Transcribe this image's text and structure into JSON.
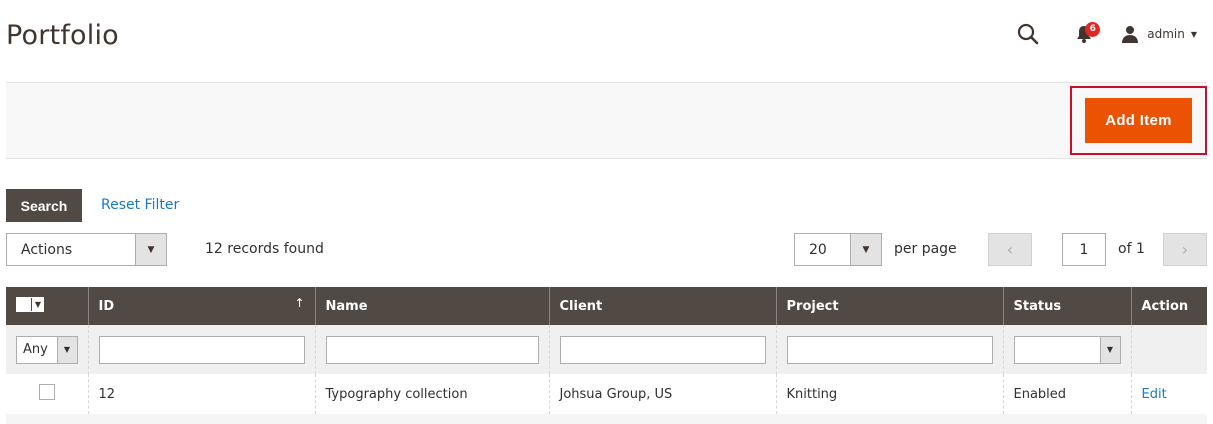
{
  "page": {
    "title": "Portfolio"
  },
  "header": {
    "notifications_count": "6",
    "user_name": "admin",
    "icons": {
      "search": "search-icon",
      "bell": "bell-icon",
      "user": "user-icon",
      "caret": "caret-down-icon"
    }
  },
  "actions_bar": {
    "add_label": "Add Item",
    "accent": "#eb5202",
    "highlight": "#c8102e"
  },
  "toolbar": {
    "search_label": "Search",
    "reset_label": "Reset Filter",
    "mass_action_value": "Actions",
    "records_text": "12 records found",
    "per_page_value": "20",
    "per_page_label": "per page",
    "current_page": "1",
    "page_of": "of 1"
  },
  "grid": {
    "columns": [
      {
        "label": ""
      },
      {
        "label": "ID",
        "sorted": "asc"
      },
      {
        "label": "Name"
      },
      {
        "label": "Client"
      },
      {
        "label": "Project"
      },
      {
        "label": "Status"
      },
      {
        "label": "Action"
      }
    ],
    "filters": {
      "select_value": "Any",
      "status_value": ""
    },
    "rows": [
      {
        "id": "12",
        "name": "Typography collection",
        "client": "Johsua Group, US",
        "project": "Knitting",
        "status": "Enabled",
        "action": "Edit"
      }
    ]
  }
}
